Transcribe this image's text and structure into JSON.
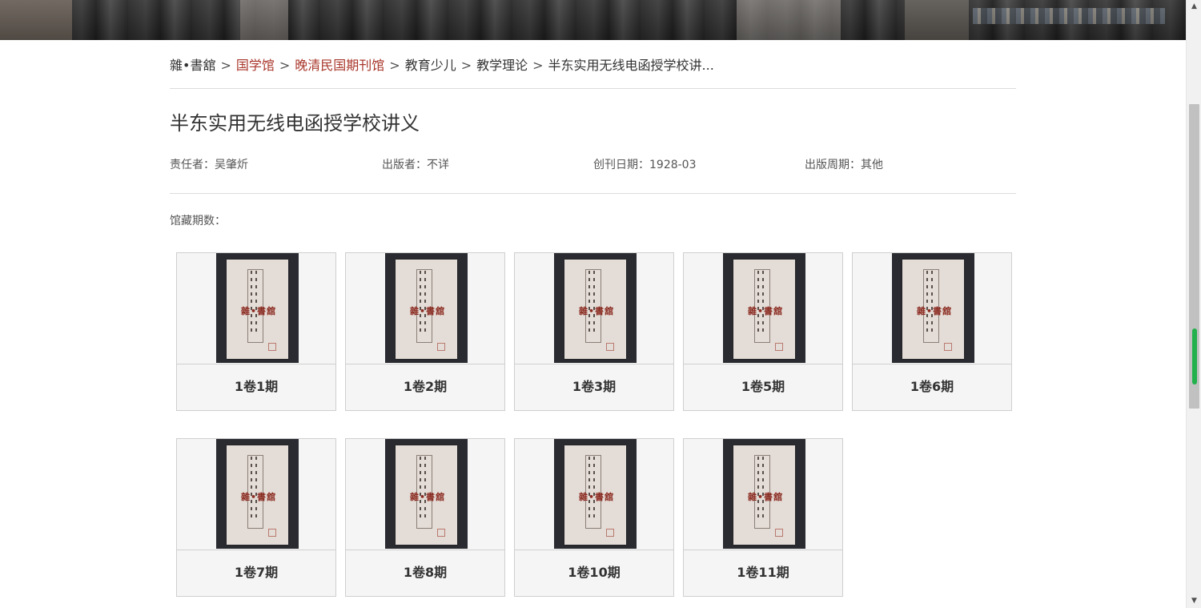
{
  "breadcrumb": {
    "site": "雜•書舘",
    "separator": ">",
    "items": [
      "国学馆",
      "晚清民国期刊馆",
      "教育少儿",
      "教学理论",
      "半东实用无线电函授学校讲..."
    ]
  },
  "title": "半东实用无线电函授学校讲义",
  "meta": {
    "editor": "责任者：吴肇炘",
    "publisher": "出版者：不详",
    "first_issue": "创刊日期：1928-03",
    "frequency": "出版周期：其他"
  },
  "holdings_label": "馆藏期数：",
  "issues": [
    {
      "label": "1卷1期"
    },
    {
      "label": "1卷2期"
    },
    {
      "label": "1卷3期"
    },
    {
      "label": "1卷5期"
    },
    {
      "label": "1卷6期"
    },
    {
      "label": "1卷7期"
    },
    {
      "label": "1卷8期"
    },
    {
      "label": "1卷10期"
    },
    {
      "label": "1卷11期"
    }
  ],
  "cover_stamp": "雜•書舘",
  "scrollbar": {
    "up_icon": "▲",
    "down_icon": "▼"
  }
}
